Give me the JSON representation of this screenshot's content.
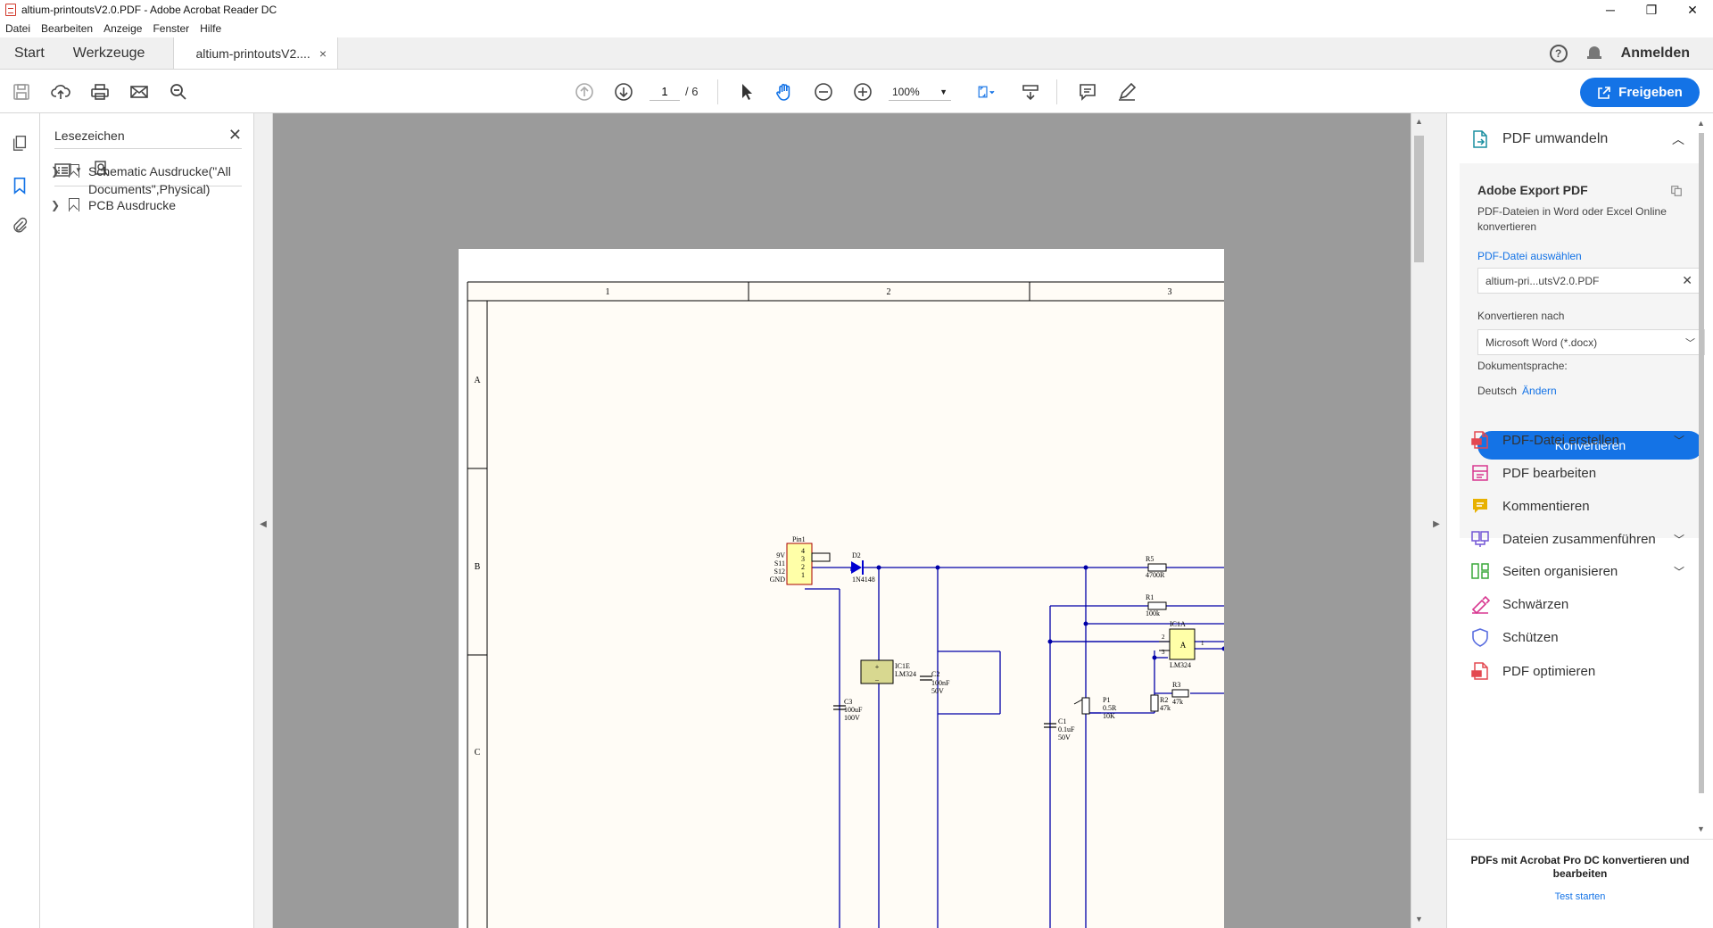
{
  "window": {
    "title": "altium-printoutsV2.0.PDF - Adobe Acrobat Reader DC",
    "controls": [
      "─",
      "❐",
      "✕"
    ]
  },
  "menu": [
    "Datei",
    "Bearbeiten",
    "Anzeige",
    "Fenster",
    "Hilfe"
  ],
  "tabs": {
    "home": "Start",
    "tools": "Werkzeuge",
    "document": "altium-printoutsV2....",
    "close": "×",
    "help": "?",
    "signin": "Anmelden"
  },
  "toolbar": {
    "page_current": "1",
    "page_total": "/ 6",
    "zoom": "100%",
    "share": "Freigeben"
  },
  "bookmarks": {
    "title": "Lesezeichen",
    "items": [
      {
        "label": "Schematic Ausdrucke(\"All Documents\",Physical)"
      },
      {
        "label": "PCB Ausdrucke"
      }
    ]
  },
  "schematic": {
    "columns": [
      "1",
      "2",
      "3"
    ],
    "rows": [
      "A",
      "B",
      "C"
    ],
    "header": "Pin1",
    "pin_labels": [
      "9V",
      "S11",
      "S12",
      "GND"
    ],
    "pin_numbers": [
      "4",
      "3",
      "2",
      "1"
    ],
    "d2": "D2",
    "d2_val": "1N4148",
    "r5": "R5",
    "r5_val": "4700R",
    "r1": "R1",
    "r1_val": "100k",
    "ic1a": "IC1A",
    "ic1a_val": "LM324",
    "ic1a_pin1": "1",
    "ic1a_pin2": "2",
    "ic1a_pin3": "3",
    "ic1a_a": "A",
    "r3": "R3",
    "r3_val": "47k",
    "r2": "R2",
    "r2_val": "47k",
    "p1": "P1",
    "p1_v1": "0.5R",
    "p1_v2": "10K",
    "ic1e": "IC1E",
    "ic1e_val": "LM324",
    "c2": "C2",
    "c2_v1": "100nF",
    "c2_v2": "50V",
    "c3": "C3",
    "c3_v1": "100uF",
    "c3_v2": "100V",
    "c1": "C1",
    "c1_v1": "0.1uF",
    "c1_v2": "50V"
  },
  "right_panel": {
    "section_title": "PDF umwandeln",
    "export_title": "Adobe Export PDF",
    "export_desc": "PDF-Dateien in Word oder Excel Online konvertieren",
    "select_file_link": "PDF-Datei auswählen",
    "selected_file": "altium-pri...utsV2.0.PDF",
    "convert_to_label": "Konvertieren nach",
    "convert_to_value": "Microsoft Word (*.docx)",
    "lang_label": "Dokumentsprache:",
    "lang_value": "Deutsch",
    "lang_change": "Ändern",
    "convert_button": "Konvertieren",
    "tools": [
      {
        "label": "PDF-Datei erstellen",
        "color": "#e34850",
        "has_chevron": true
      },
      {
        "label": "PDF bearbeiten",
        "color": "#d83790",
        "has_chevron": false
      },
      {
        "label": "Kommentieren",
        "color": "#e8b100",
        "has_chevron": false
      },
      {
        "label": "Dateien zusammenführen",
        "color": "#7357d5",
        "has_chevron": true
      },
      {
        "label": "Seiten organisieren",
        "color": "#3aa83a",
        "has_chevron": true
      },
      {
        "label": "Schwärzen",
        "color": "#d83790",
        "has_chevron": false
      },
      {
        "label": "Schützen",
        "color": "#5a6ee0",
        "has_chevron": false
      },
      {
        "label": "PDF optimieren",
        "color": "#e34850",
        "has_chevron": false
      }
    ],
    "promo_text": "PDFs mit Acrobat Pro DC konvertieren und bearbeiten",
    "promo_link": "Test starten"
  },
  "colors": {
    "accent": "#1473e6",
    "doc_background": "#9b9b9b",
    "schematic_paper": "#fffcf6",
    "wire": "#0000a8",
    "component_fill": "#ffffa8",
    "component_border": "#a80000"
  }
}
